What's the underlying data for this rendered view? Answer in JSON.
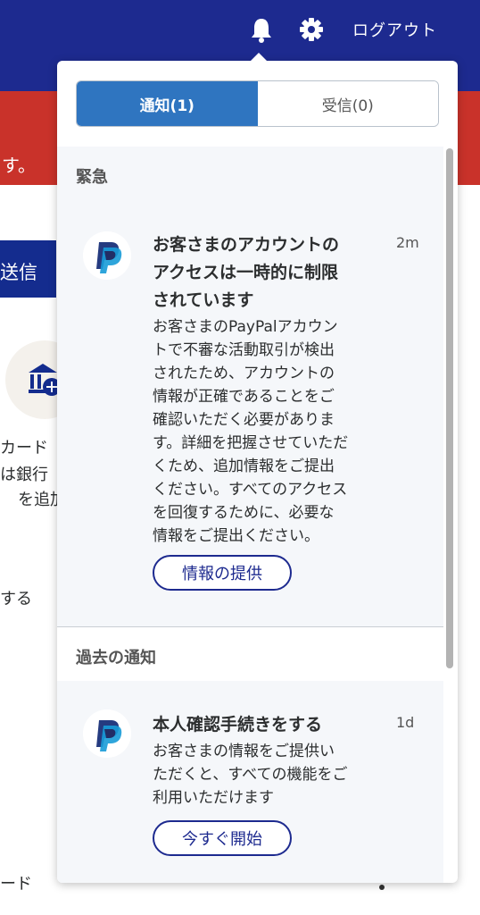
{
  "header": {
    "logout_label": "ログアウト",
    "bell_icon": "bell-icon",
    "gear_icon": "gear-icon"
  },
  "alert_banner": {
    "text": "す。"
  },
  "background": {
    "send_button": "送信",
    "bank_icon": "bank-add-icon",
    "lines": [
      "カード",
      "は銀行",
      "を追加",
      "する",
      "ード"
    ]
  },
  "popover": {
    "tabs": [
      {
        "label": "通知(1)",
        "active": true
      },
      {
        "label": "受信(0)",
        "active": false
      }
    ],
    "urgent": {
      "heading": "緊急",
      "title_lines": [
        "お客さまのアカウントの",
        "アクセスは一時的に制限",
        "されています"
      ],
      "time": "2m",
      "body_lines": [
        "お客さまのPayPalアカウン",
        "トで不審な活動取引が検出",
        "されたため、アカウントの",
        "情報が正確であることをご",
        "確認いただく必要がありま",
        "す。詳細を把握させていただ",
        "くため、追加情報をご提出",
        "ください。すべてのアクセス",
        "を回復するために、必要な",
        "情報をご提出ください。"
      ],
      "action": "情報の提供"
    },
    "past": {
      "heading": "過去の通知",
      "title": "本人確認手続きをする",
      "time": "1d",
      "body_lines": [
        "お客さまの情報をご提供い",
        "ただくと、すべての機能をご",
        "利用いただけます"
      ],
      "action": "今すぐ開始"
    }
  },
  "colors": {
    "header": "#1d2a8f",
    "alert": "#c9322a",
    "tab_active": "#2f75c0",
    "button_border": "#1d2a8f"
  }
}
